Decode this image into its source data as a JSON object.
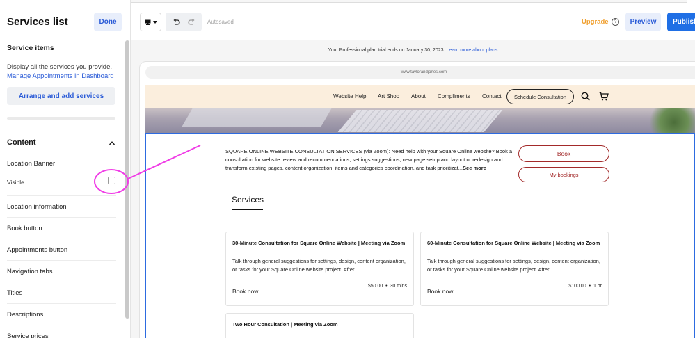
{
  "sidebar": {
    "title": "Services list",
    "done_label": "Done",
    "service_items_title": "Service items",
    "service_items_desc": "Display all the services you provide.",
    "manage_link": "Manage Appointments in Dashboard",
    "arrange_label": "Arrange and add services",
    "content_title": "Content",
    "location_banner": "Location Banner",
    "visible_label": "Visible",
    "items": [
      {
        "label": "Location information"
      },
      {
        "label": "Book button"
      },
      {
        "label": "Appointments button"
      },
      {
        "label": "Navigation tabs"
      },
      {
        "label": "Titles"
      },
      {
        "label": "Descriptions"
      },
      {
        "label": "Service prices"
      }
    ]
  },
  "toolbar": {
    "autosaved": "Autosaved",
    "upgrade": "Upgrade",
    "preview": "Preview",
    "publish": "Publish"
  },
  "trial": {
    "text": "Your Professional plan trial ends on January 30, 2023.",
    "link": "Learn more about plans"
  },
  "browser": {
    "url": "www.taylorandjones.com"
  },
  "site": {
    "nav": [
      "Website Help",
      "Art Shop",
      "About",
      "Compliments",
      "Contact"
    ],
    "schedule_label": "Schedule Consultation",
    "description": "SQUARE ONLINE WEBSITE CONSULTATION SERVICES (via Zoom): Need help with your Square Online website? Book a consultation for website review and recommendations, settings suggestions, new page setup and layout or redesign and transform existing pages, content organization, items and categories coordination, and task prioritizat...",
    "see_more": "See more",
    "book_label": "Book",
    "my_bookings_label": "My bookings",
    "services_heading": "Services",
    "cards": [
      {
        "title": "30-Minute Consultation for Square Online Website | Meeting via Zoom",
        "desc": "Talk through general suggestions for settings, design, content organization, or tasks for your Square Online website project. After...",
        "price": "$50.00",
        "duration": "30 mins",
        "book": "Book now"
      },
      {
        "title": "60-Minute Consultation for Square Online Website | Meeting via Zoom",
        "desc": "Talk through general suggestions for settings, design, content organization, or tasks for your Square Online website project. After...",
        "price": "$100.00",
        "duration": "1 hr",
        "book": "Book now"
      },
      {
        "title": "Two Hour Consultation | Meeting via Zoom"
      }
    ]
  },
  "colors": {
    "accent_blue": "#2a5bd7",
    "publish_blue": "#1f6fe5",
    "upgrade_orange": "#f0a030",
    "book_red": "#a32a2a",
    "nav_beige": "#fbeedd",
    "annotation_magenta": "#f03ce6",
    "selection_blue": "#2d6be0"
  },
  "icons": {
    "device": "desktop-icon",
    "undo": "undo-icon",
    "redo": "redo-icon",
    "help": "help-circle-icon",
    "search": "search-icon",
    "cart": "cart-icon",
    "collapse": "chevron-up-icon"
  }
}
